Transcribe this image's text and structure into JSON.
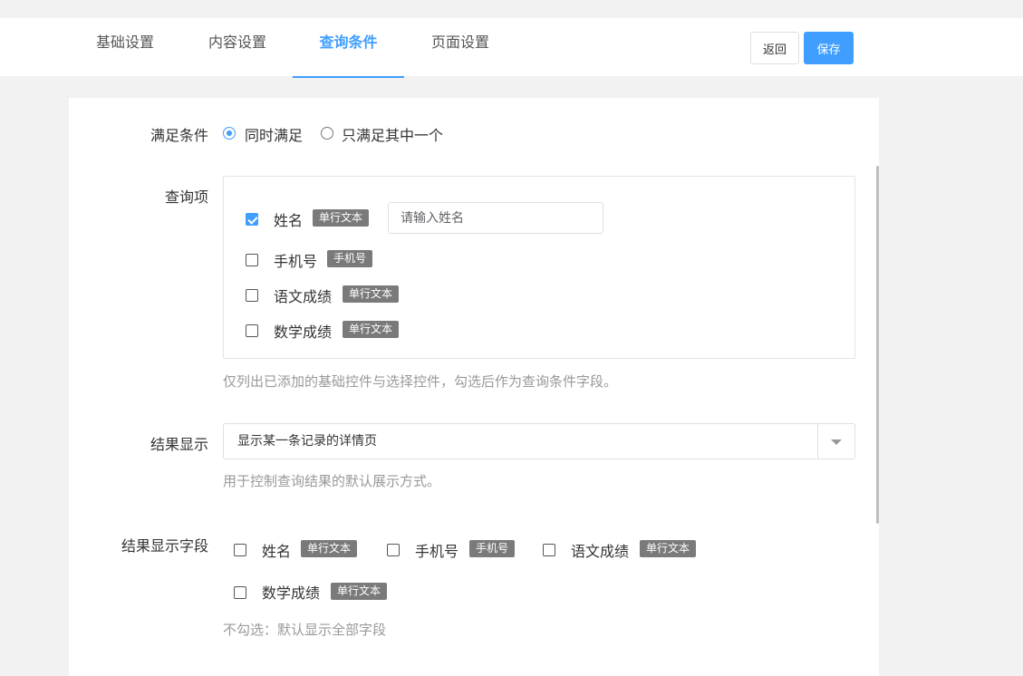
{
  "tabs": [
    {
      "label": "基础设置"
    },
    {
      "label": "内容设置"
    },
    {
      "label": "查询条件"
    },
    {
      "label": "页面设置"
    }
  ],
  "toolbar": {
    "back_label": "返回",
    "save_label": "保存"
  },
  "condition": {
    "label": "满足条件",
    "options": [
      {
        "label": "同时满足",
        "checked": true
      },
      {
        "label": "只满足其中一个",
        "checked": false
      }
    ]
  },
  "query": {
    "label": "查询项",
    "items": [
      {
        "name": "姓名",
        "tag": "单行文本",
        "checked": true,
        "placeholder": "请输入姓名"
      },
      {
        "name": "手机号",
        "tag": "手机号",
        "checked": false
      },
      {
        "name": "语文成绩",
        "tag": "单行文本",
        "checked": false
      },
      {
        "name": "数学成绩",
        "tag": "单行文本",
        "checked": false
      }
    ],
    "hint": "仅列出已添加的基础控件与选择控件，勾选后作为查询条件字段。"
  },
  "result": {
    "label": "结果显示",
    "selected": "显示某一条记录的详情页",
    "hint": "用于控制查询结果的默认展示方式。"
  },
  "fields": {
    "label": "结果显示字段",
    "items": [
      {
        "name": "姓名",
        "tag": "单行文本",
        "checked": false
      },
      {
        "name": "手机号",
        "tag": "手机号",
        "checked": false
      },
      {
        "name": "语文成绩",
        "tag": "单行文本",
        "checked": false
      },
      {
        "name": "数学成绩",
        "tag": "单行文本",
        "checked": false
      }
    ],
    "hint": "不勾选：默认显示全部字段"
  },
  "colors": {
    "accent": "#409eff",
    "tag_bg": "#7a7a7a"
  }
}
